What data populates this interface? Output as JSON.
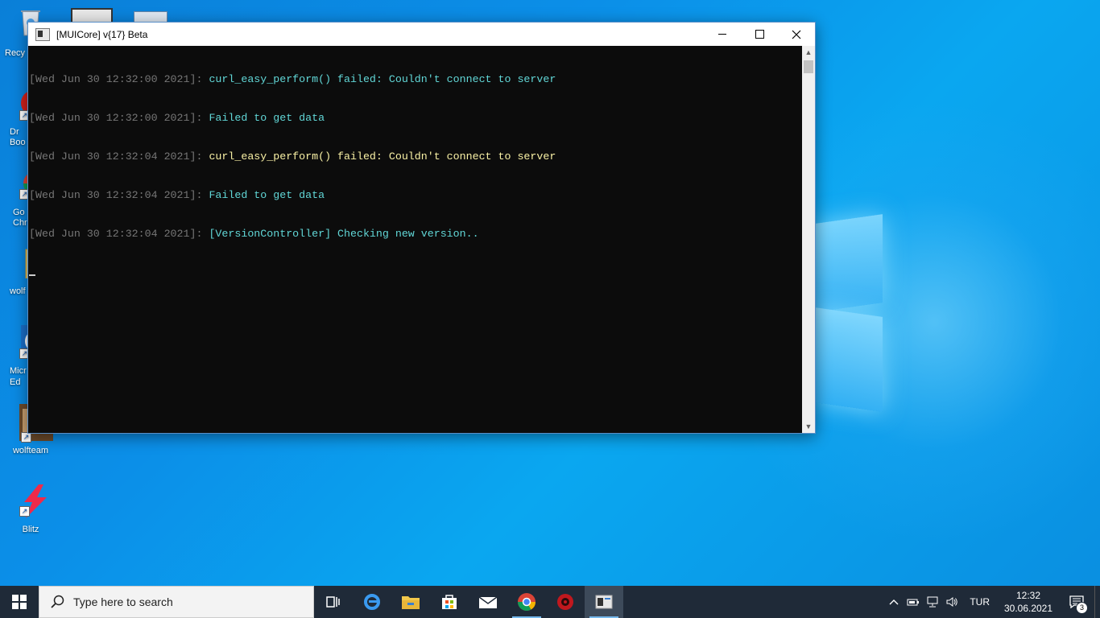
{
  "desktop": {
    "icons": [
      {
        "label": "Recy",
        "icon": "recycle-bin-icon"
      },
      {
        "label": "Dr\nBoo",
        "icon": "driver-booster-icon"
      },
      {
        "label": "Go\nChr",
        "icon": "chrome-icon"
      },
      {
        "label": "wolf",
        "icon": "folder-icon"
      },
      {
        "label": "Micr\nEd",
        "icon": "edge-icon"
      },
      {
        "label": "wolfteam",
        "icon": "wolfteam-icon"
      },
      {
        "label": "Blitz",
        "icon": "blitz-icon"
      }
    ]
  },
  "console": {
    "title": "[MUICore] v{17} Beta",
    "lines": [
      {
        "ts": "[Wed Jun 30 12:32:00 2021]: ",
        "msg": "curl_easy_perform() failed: Couldn't connect to server",
        "color": "#61d6d6"
      },
      {
        "ts": "[Wed Jun 30 12:32:00 2021]: ",
        "msg": "Failed to get data",
        "color": "#61d6d6"
      },
      {
        "ts": "[Wed Jun 30 12:32:04 2021]: ",
        "msg": "curl_easy_perform() failed: Couldn't connect to server",
        "color": "#f9f1a5"
      },
      {
        "ts": "[Wed Jun 30 12:32:04 2021]: ",
        "msg": "Failed to get data",
        "color": "#61d6d6"
      },
      {
        "ts": "[Wed Jun 30 12:32:04 2021]: ",
        "msg": "[VersionController] Checking new version..",
        "color": "#61d6d6"
      }
    ]
  },
  "taskbar": {
    "search_placeholder": "Type here to search",
    "apps": [
      "task-view-icon",
      "edge-icon",
      "file-explorer-icon",
      "store-icon",
      "mail-icon",
      "chrome-icon",
      "game-app-icon",
      "console-app-icon"
    ],
    "lang": "TUR",
    "time": "12:32",
    "date": "30.06.2021",
    "notification_count": "3"
  },
  "colors": {
    "taskbar_bg": "#1f2a38",
    "console_bg": "#0c0c0c",
    "accent": "#76b9ed"
  }
}
